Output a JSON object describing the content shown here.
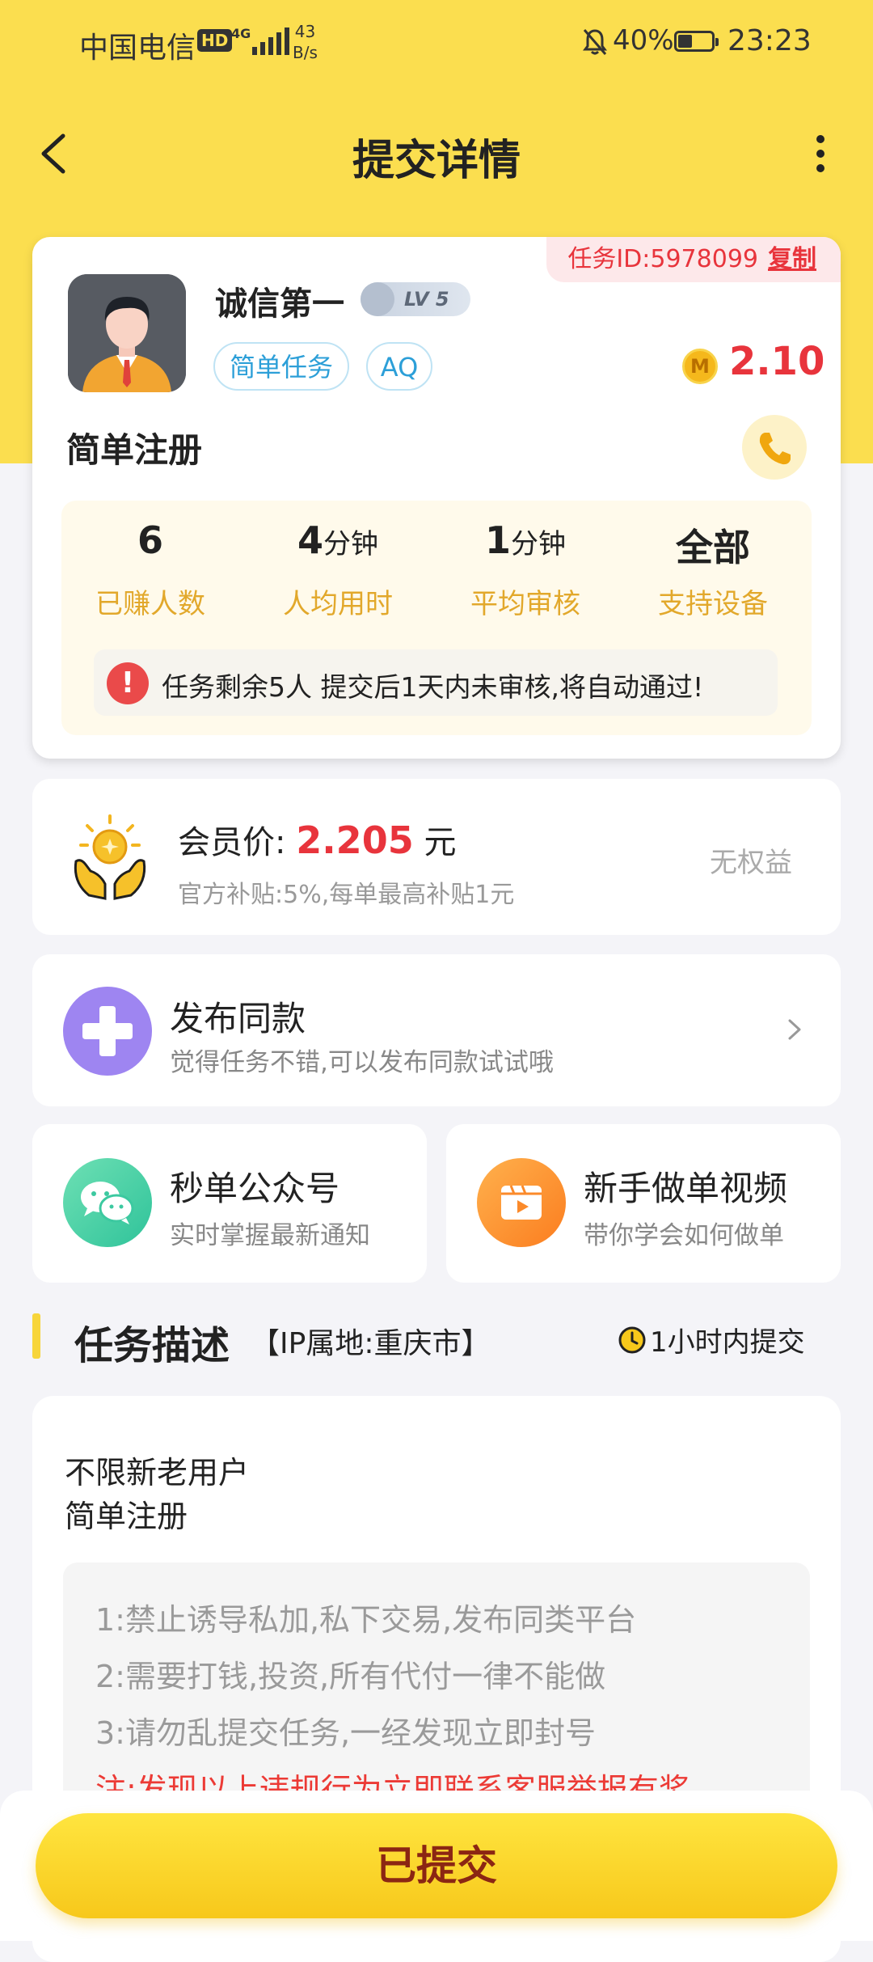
{
  "status_bar": {
    "carrier": "中国电信",
    "hd_badge": "HD",
    "signal_type": "4G",
    "net_speed_value": "43",
    "net_speed_unit": "B/s",
    "battery": "40%",
    "time": "23:23"
  },
  "header": {
    "title": "提交详情"
  },
  "task_card": {
    "task_id_label": "任务ID:5978099",
    "copy_label": "复制",
    "username": "诚信第一",
    "level": "LV 5",
    "tags": [
      "简单任务",
      "AQ"
    ],
    "coin_symbol": "M",
    "reward": "2.10",
    "task_name": "简单注册",
    "stats": [
      {
        "value": "6",
        "unit": "",
        "label": "已赚人数"
      },
      {
        "value": "4",
        "unit": "分钟",
        "label": "人均用时"
      },
      {
        "value": "1",
        "unit": "分钟",
        "label": "平均审核"
      },
      {
        "value": "全部",
        "unit": "",
        "label": "支持设备"
      }
    ],
    "notice_icon": "!",
    "notice": "任务剩余5人  提交后1天内未审核,将自动通过!"
  },
  "member": {
    "label": "会员价:",
    "price": "2.205",
    "unit": "元",
    "subsidy": "官方补贴:5%,每单最高补贴1元",
    "right_text": "无权益"
  },
  "publish": {
    "title": "发布同款",
    "subtitle": "觉得任务不错,可以发布同款试试哦"
  },
  "wechat": {
    "title": "秒单公众号",
    "subtitle": "实时掌握最新通知"
  },
  "video": {
    "title": "新手做单视频",
    "subtitle": "带你学会如何做单"
  },
  "description": {
    "title": "任务描述",
    "ip": "【IP属地:重庆市】",
    "time_limit": "1小时内提交",
    "lines": [
      "不限新老用户",
      "简单注册"
    ],
    "rules": [
      "1:禁止诱导私加,私下交易,发布同类平台",
      "2:需要打钱,投资,所有代付一律不能做",
      "3:请勿乱提交任务,一经发现立即封号",
      "注:发现以上违规行为立即联系客服举报有奖"
    ]
  },
  "bottom": {
    "submit_label": "已提交"
  },
  "colors": {
    "accent_yellow": "#fbde4f",
    "price_red": "#e8343c",
    "stat_label_gold": "#e2a82b",
    "tag_blue": "#2c9fd8"
  }
}
